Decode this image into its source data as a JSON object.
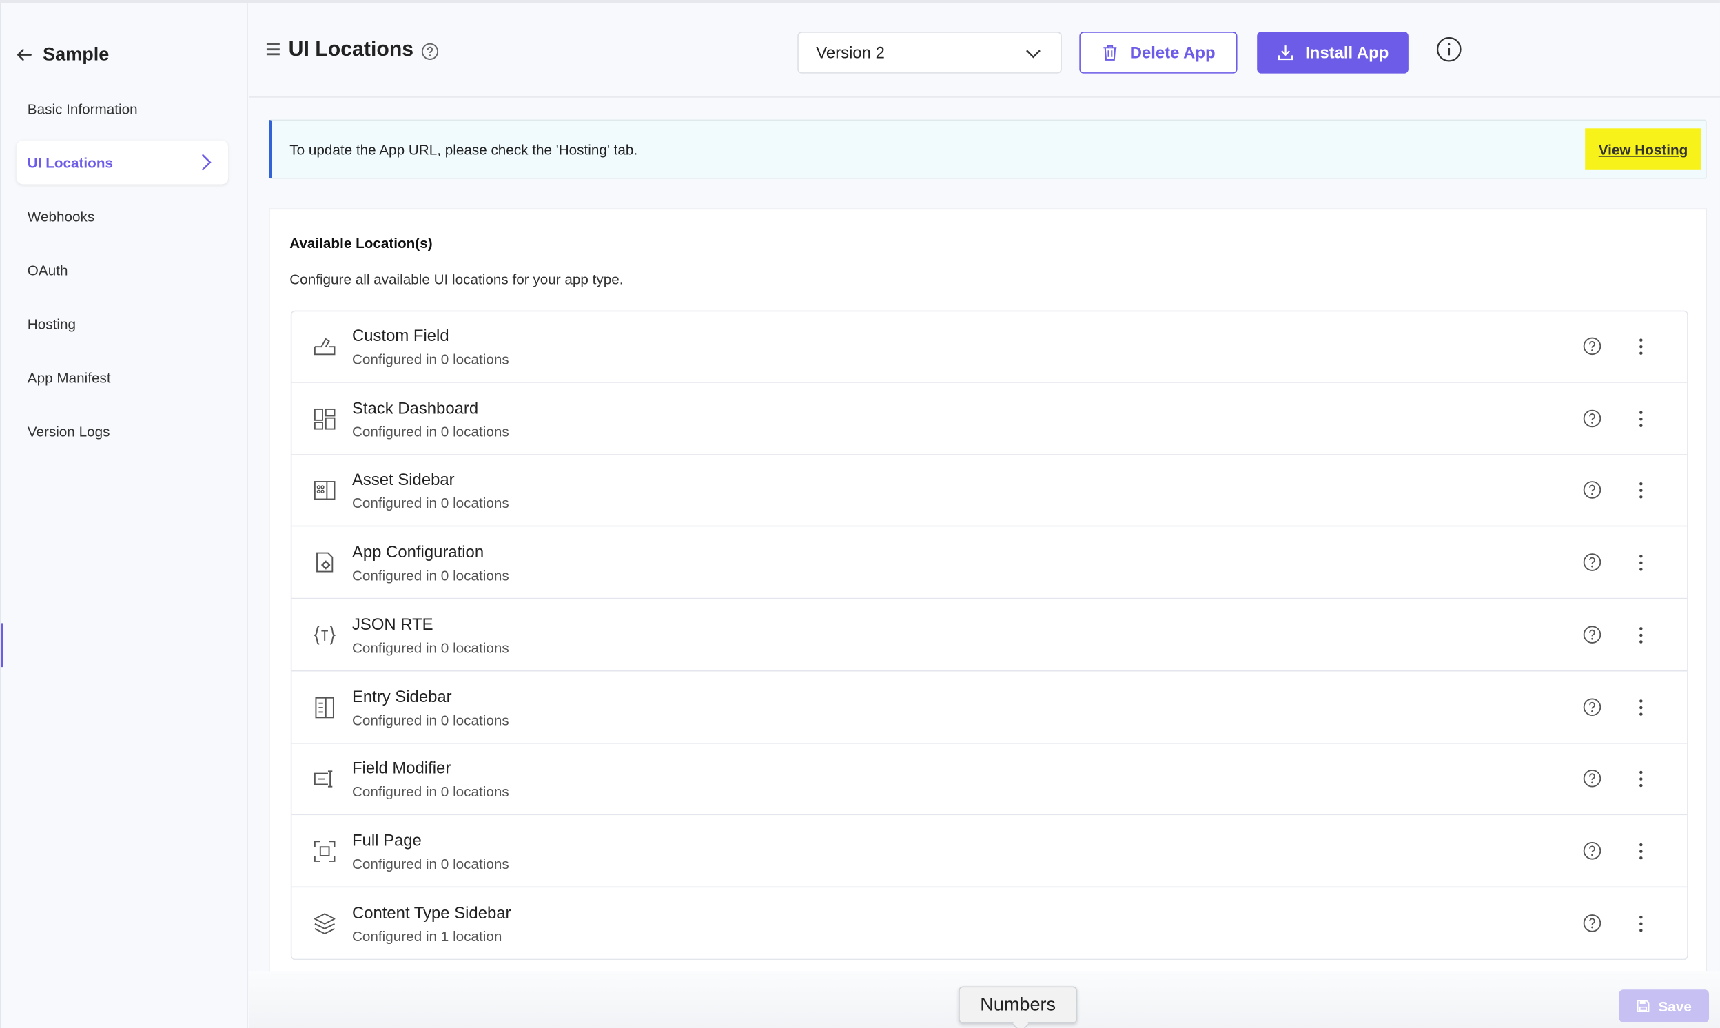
{
  "sidebar": {
    "app_name": "Sample",
    "items": [
      {
        "label": "Basic Information"
      },
      {
        "label": "UI Locations",
        "active": true
      },
      {
        "label": "Webhooks"
      },
      {
        "label": "OAuth"
      },
      {
        "label": "Hosting"
      },
      {
        "label": "App Manifest"
      },
      {
        "label": "Version Logs"
      }
    ]
  },
  "header": {
    "title": "UI Locations",
    "version_selected": "Version 2",
    "delete_label": "Delete App",
    "install_label": "Install App"
  },
  "notice": {
    "message": "To update the App URL, please check the 'Hosting' tab.",
    "link_label": "View Hosting"
  },
  "locations": {
    "title": "Available Location(s)",
    "description": "Configure all available UI locations for your app type.",
    "rows": [
      {
        "name": "Custom Field",
        "status": "Configured in 0 locations",
        "icon": "custom-field-icon"
      },
      {
        "name": "Stack Dashboard",
        "status": "Configured in 0 locations",
        "icon": "dashboard-icon"
      },
      {
        "name": "Asset Sidebar",
        "status": "Configured in 0 locations",
        "icon": "asset-sidebar-icon"
      },
      {
        "name": "App Configuration",
        "status": "Configured in 0 locations",
        "icon": "app-config-icon"
      },
      {
        "name": "JSON RTE",
        "status": "Configured in 0 locations",
        "icon": "json-rte-icon"
      },
      {
        "name": "Entry Sidebar",
        "status": "Configured in 0 locations",
        "icon": "entry-sidebar-icon"
      },
      {
        "name": "Field Modifier",
        "status": "Configured in 0 locations",
        "icon": "field-modifier-icon"
      },
      {
        "name": "Full Page",
        "status": "Configured in 0 locations",
        "icon": "full-page-icon"
      },
      {
        "name": "Content Type Sidebar",
        "status": "Configured in 1 location",
        "icon": "layers-icon"
      }
    ]
  },
  "footer": {
    "tooltip": "Numbers",
    "save_label": "Save"
  },
  "colors": {
    "accent": "#6c5ce7",
    "notice_border": "#2f63d6",
    "highlight": "#f7f21a"
  }
}
